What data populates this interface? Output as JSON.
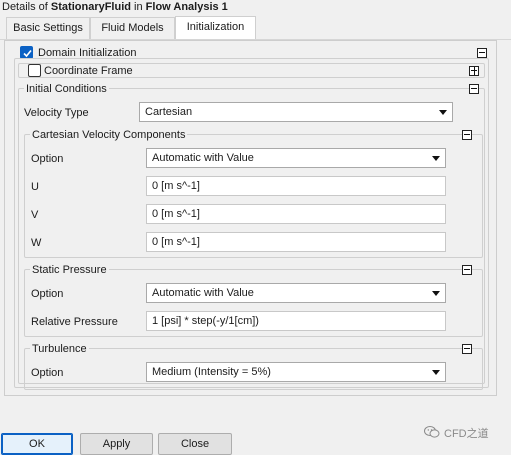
{
  "title": {
    "prefix": "Details of",
    "object": "StationaryFluid",
    "middle": "in",
    "analysis": "Flow Analysis 1"
  },
  "tabs": [
    {
      "label": "Basic Settings",
      "active": false
    },
    {
      "label": "Fluid Models",
      "active": false
    },
    {
      "label": "Initialization",
      "active": true
    }
  ],
  "domain_initialization": {
    "label": "Domain Initialization",
    "checked": true
  },
  "coordinate_frame": {
    "label": "Coordinate Frame",
    "checked": false
  },
  "initial_conditions": {
    "label": "Initial Conditions",
    "velocity_type": {
      "label": "Velocity Type",
      "value": "Cartesian"
    },
    "cartesian_velocity": {
      "label": "Cartesian Velocity Components",
      "option": {
        "label": "Option",
        "value": "Automatic with Value"
      },
      "u": {
        "label": "U",
        "value": "0 [m s^-1]"
      },
      "v": {
        "label": "V",
        "value": "0 [m s^-1]"
      },
      "w": {
        "label": "W",
        "value": "0 [m s^-1]"
      }
    },
    "static_pressure": {
      "label": "Static Pressure",
      "option": {
        "label": "Option",
        "value": "Automatic with Value"
      },
      "relative_pressure": {
        "label": "Relative Pressure",
        "value": "1 [psi] * step(-y/1[cm])"
      }
    },
    "turbulence": {
      "label": "Turbulence",
      "option": {
        "label": "Option",
        "value": "Medium (Intensity = 5%)"
      }
    }
  },
  "buttons": {
    "ok": "OK",
    "apply": "Apply",
    "close": "Close"
  },
  "watermark": {
    "icon": "wechat-icon",
    "text": "CFD之道"
  },
  "colors": {
    "accent": "#0b61c4",
    "background": "#f0f0f0"
  }
}
